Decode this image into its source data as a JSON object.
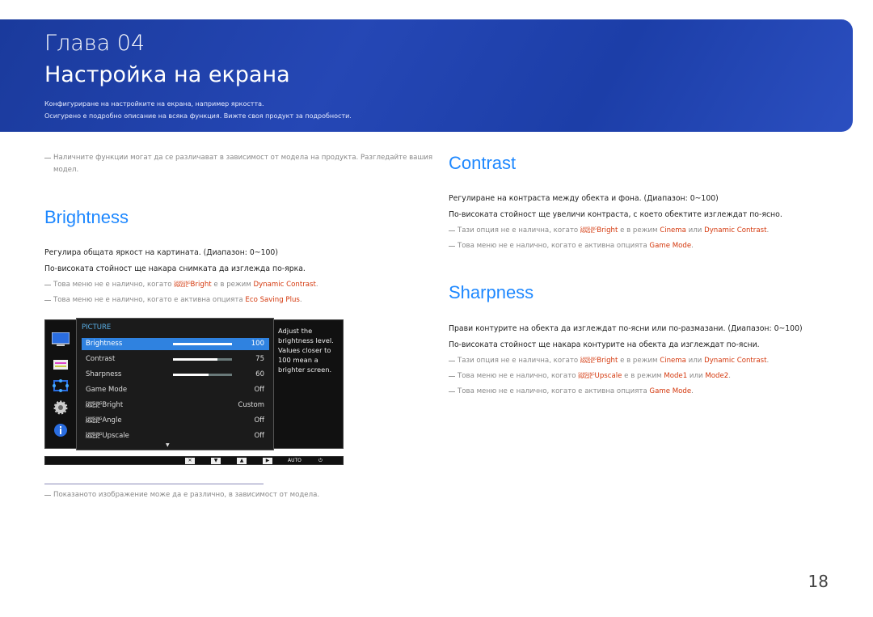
{
  "header": {
    "chapter": "Глава  04",
    "title": "Настройка на екрана",
    "subtitle1": "Конфигуриране на настройките на екрана, например яркостта.",
    "subtitle2": "Осигурено е подробно описание на всяка функция. Вижте своя продукт за подробности."
  },
  "intro_note": [
    "Наличните функции могат да се различават в зависимост от модела на продукта. Разгледайте вашия",
    "модел."
  ],
  "brightness": {
    "heading": "Brightness",
    "p1": "Регулира общата яркост на картината. (Диапазон: 0~100)",
    "p2": "По-високата стойност ще накара снимката да изглежда по-ярка.",
    "notes": [
      [
        {
          "t": "Това меню не е налично, когато "
        },
        {
          "m": "Bright"
        },
        {
          "t": " е в режим "
        },
        {
          "h": "Dynamic Contrast"
        },
        {
          "t": "."
        }
      ],
      [
        {
          "t": "Това меню не е налично, когато е активна опцията "
        },
        {
          "h": "Eco Saving Plus"
        },
        {
          "t": "."
        }
      ]
    ]
  },
  "contrast": {
    "heading": "Contrast",
    "p1": "Регулиране на контраста между обекта и фона. (Диапазон: 0~100)",
    "p2": "По-високата стойност ще увеличи контраста, с което обектите изглеждат по-ясно.",
    "notes": [
      [
        {
          "t": "Тази опция не е налична, когато "
        },
        {
          "m": "Bright"
        },
        {
          "t": " е в режим "
        },
        {
          "h": "Cinema"
        },
        {
          "t": " или "
        },
        {
          "h": "Dynamic Contrast"
        },
        {
          "t": "."
        }
      ],
      [
        {
          "t": "Това меню не е налично, когато е активна опцията "
        },
        {
          "h": "Game Mode"
        },
        {
          "t": "."
        }
      ]
    ]
  },
  "sharpness": {
    "heading": "Sharpness",
    "p1": "Прави контурите на обекта да изглеждат по-ясни или по-размазани. (Диапазон: 0~100)",
    "p2": "По-високата стойност ще накара контурите на обекта да изглеждат по-ясни.",
    "notes": [
      [
        {
          "t": "Тази опция не е налична, когато "
        },
        {
          "m": "Bright"
        },
        {
          "t": " е в режим "
        },
        {
          "h": "Cinema"
        },
        {
          "t": " или "
        },
        {
          "h": "Dynamic Contrast"
        },
        {
          "t": "."
        }
      ],
      [
        {
          "t": "Това меню не е налично, когато "
        },
        {
          "m": "Upscale"
        },
        {
          "t": " е в режим "
        },
        {
          "h": "Mode1"
        },
        {
          "t": " или "
        },
        {
          "h": "Mode2"
        },
        {
          "t": "."
        }
      ],
      [
        {
          "t": "Това меню не е налично, когато е активна опцията "
        },
        {
          "h": "Game Mode"
        },
        {
          "t": "."
        }
      ]
    ]
  },
  "osd": {
    "title": "PICTURE",
    "magic_top": "SAMSUNG",
    "magic_bottom": "MAGIC",
    "rows": [
      {
        "label": "Brightness",
        "value": "100",
        "level": 100,
        "selected": true
      },
      {
        "label": "Contrast",
        "value": "75",
        "level": 75
      },
      {
        "label": "Sharpness",
        "value": "60",
        "level": 60
      },
      {
        "label": "Game Mode",
        "value": "Off"
      },
      {
        "label": "Bright",
        "magic": true,
        "value": "Custom"
      },
      {
        "label": "Angle",
        "magic": true,
        "value": "Off"
      },
      {
        "label": "Upscale",
        "magic": true,
        "value": "Off"
      }
    ],
    "help": "Adjust the brightness level. Values closer to 100 mean a brighter screen.",
    "more": "▼",
    "keys": [
      "✕",
      "▼",
      "▲",
      "▶",
      "AUTO",
      "⏻"
    ]
  },
  "footnote": "Показаното изображение може да е различно, в зависимост от модела.",
  "page_number": "18"
}
